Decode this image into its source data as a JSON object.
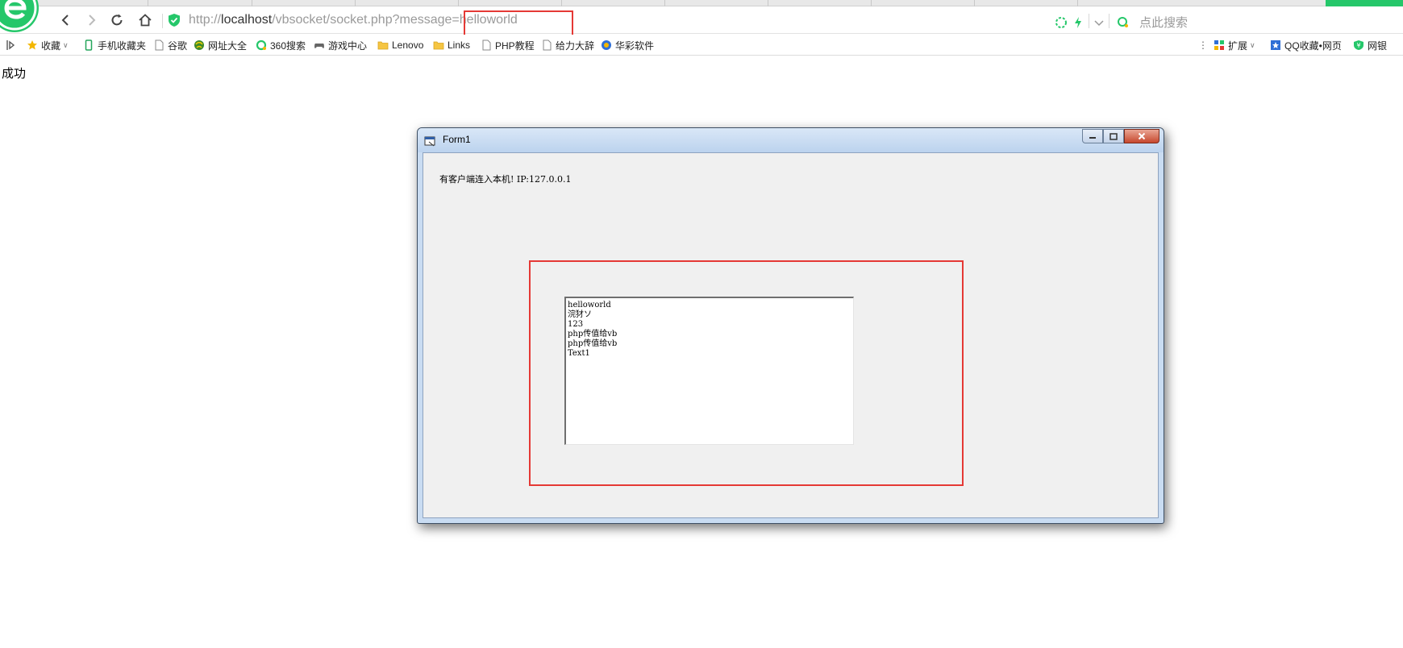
{
  "browser": {
    "tabs_count": 9,
    "nav": {
      "back_icon": "back-arrow-icon",
      "forward_icon": "forward-arrow-icon",
      "refresh_icon": "refresh-icon",
      "home_icon": "home-icon"
    },
    "address": {
      "scheme": "http://",
      "host": "localhost",
      "path": "/vbsocket/socket.php?message=helloworld"
    },
    "search_placeholder": "点此搜索",
    "accent_color": "#25c76a",
    "highlight_color": "#e53935"
  },
  "bookmarks": {
    "left": [
      {
        "label": "收藏",
        "icon": "star-icon"
      },
      {
        "label": "手机收藏夹",
        "icon": "phone-icon"
      },
      {
        "label": "谷歌",
        "icon": "page-icon"
      },
      {
        "label": "网址大全",
        "icon": "globe-icon"
      },
      {
        "label": "360搜索",
        "icon": "search-360-icon"
      },
      {
        "label": "游戏中心",
        "icon": "gamepad-icon"
      },
      {
        "label": "Lenovo",
        "icon": "folder-icon"
      },
      {
        "label": "Links",
        "icon": "folder-icon"
      },
      {
        "label": "PHP教程",
        "icon": "page-icon"
      },
      {
        "label": "给力大辞",
        "icon": "page-icon"
      },
      {
        "label": "华彩软件",
        "icon": "app-icon"
      }
    ],
    "right": [
      {
        "label": "扩展",
        "icon": "extension-icon"
      },
      {
        "label": "QQ收藏•网页",
        "icon": "qq-bookmark-icon"
      },
      {
        "label": "网银",
        "icon": "bank-shield-icon"
      }
    ]
  },
  "page": {
    "message": "成功"
  },
  "form": {
    "title": "Form1",
    "label": "有客户端连入本机! IP:127.0.0.1",
    "textbox_lines": [
      "helloworld",
      "浣犲ソ",
      "123",
      "php传值给vb",
      "php传值给vb",
      "Text1"
    ]
  }
}
